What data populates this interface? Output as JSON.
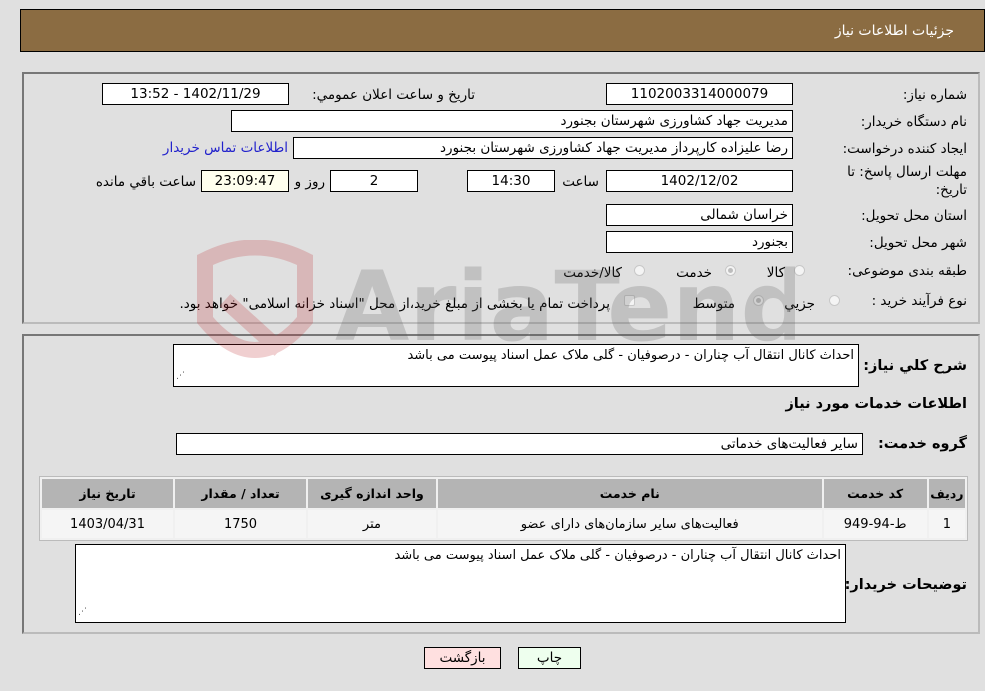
{
  "header": {
    "title": "جزئیات اطلاعات نیاز"
  },
  "form": {
    "need_number": {
      "label": "شماره نیاز:",
      "value": "1102003314000079"
    },
    "announce_datetime": {
      "label": "تاریخ و ساعت اعلان عمومي:",
      "value": "1402/11/29 - 13:52"
    },
    "buyer_org": {
      "label": "نام دستگاه خریدار:",
      "value": "مدیریت جهاد کشاورزی شهرستان بجنورد"
    },
    "requester": {
      "label": "ایجاد کننده درخواست:",
      "value": "رضا  علیزاده کارپرداز مدیریت جهاد کشاورزی شهرستان بجنورد"
    },
    "contact_link": "اطلاعات تماس خریدار",
    "deadline": {
      "label_line1": "مهلت ارسال پاسخ: تا",
      "label_line2": "تاریخ:",
      "date": "1402/12/02",
      "time_label": "ساعت",
      "time": "14:30",
      "days": "2",
      "days_label": "روز و",
      "remaining": "23:09:47",
      "remaining_label": "ساعت باقي مانده"
    },
    "province": {
      "label": "استان محل تحویل:",
      "value": "خراسان شمالی"
    },
    "city": {
      "label": "شهر محل تحویل:",
      "value": "بجنورد"
    },
    "category": {
      "label": "طبقه بندی موضوعی:",
      "options": [
        "کالا",
        "خدمت",
        "کالا/خدمت"
      ],
      "selected": "خدمت"
    },
    "purchase_type": {
      "label": "نوع فرآیند خرید :",
      "options": [
        "جزیي",
        "متوسط"
      ],
      "selected": "متوسط",
      "treasury_note": "پرداخت تمام یا بخشی از مبلغ خرید،از محل \"اسناد خزانه اسلامی\" خواهد بود."
    }
  },
  "details": {
    "summary_label": "شرح کلي نیاز:",
    "summary_value": "احداث کانال انتقال آب چناران - درصوفیان - گلی  ملاک عمل اسناد پیوست می باشد",
    "services_title": "اطلاعات خدمات مورد نیاز",
    "service_group_label": "گروه خدمت:",
    "service_group_value": "سایر فعالیت‌های خدماتی",
    "table": {
      "headers": [
        "ردیف",
        "کد خدمت",
        "نام خدمت",
        "واحد اندازه گیری",
        "تعداد / مقدار",
        "تاریخ نیاز"
      ],
      "rows": [
        [
          "1",
          "ط-94-949",
          "فعالیت‌های سایر سازمان‌های دارای عضو",
          "متر",
          "1750",
          "1403/04/31"
        ]
      ]
    },
    "buyer_notes_label": "توضیحات خریدار:",
    "buyer_notes_value": "احداث کانال انتقال آب چناران - درصوفیان - گلی  ملاک عمل اسناد پیوست می باشد"
  },
  "buttons": {
    "print": "چاپ",
    "back": "بازگشت"
  },
  "colors": {
    "header_bg": "#8b6c42",
    "print_bg": "#eeffee",
    "back_bg": "#ffe0e0",
    "link": "#2222cc"
  },
  "watermark": "AriaTender.neT"
}
